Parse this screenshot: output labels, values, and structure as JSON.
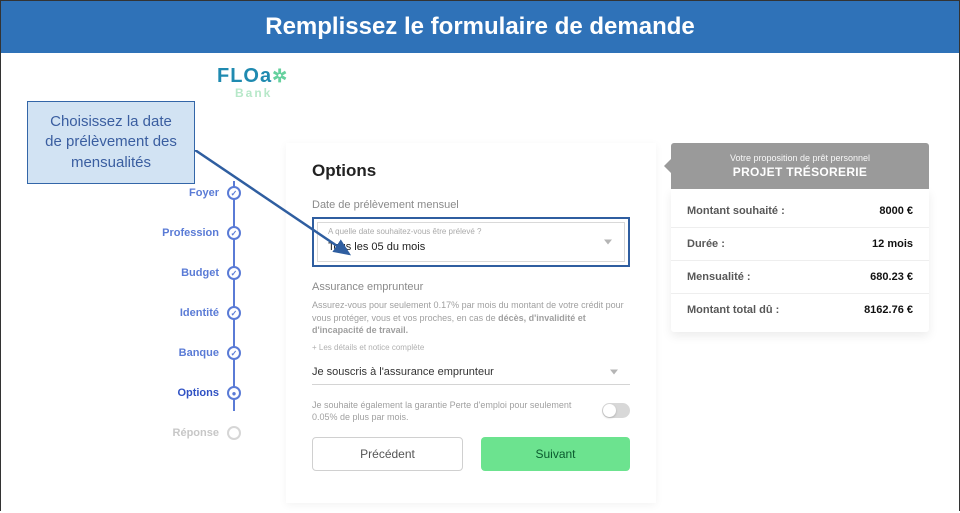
{
  "header": {
    "title": "Remplissez le formulaire de demande"
  },
  "logo": {
    "brand": "FLOa",
    "accent": "✲",
    "sub": "Bank"
  },
  "callout": {
    "text": "Choisissez la date de prélèvement des mensualités"
  },
  "steps": [
    {
      "label": "Foyer"
    },
    {
      "label": "Profession"
    },
    {
      "label": "Budget"
    },
    {
      "label": "Identité"
    },
    {
      "label": "Banque"
    },
    {
      "label": "Options"
    },
    {
      "label": "Réponse"
    }
  ],
  "form": {
    "title": "Options",
    "date_section_label": "Date de prélèvement mensuel",
    "date_select": {
      "mini_label": "A quelle date souhaitez-vous être prélevé ?",
      "value": "Tous les 05 du mois"
    },
    "insurance_section_label": "Assurance emprunteur",
    "insurance_info_prefix": "Assurez-vous pour seulement 0.17% par mois du montant de votre crédit pour vous protéger, vous et vos proches, en cas de ",
    "insurance_info_bold": "décès, d'invalidité et d'incapacité de travail.",
    "insurance_link": "+ Les détails et notice complète",
    "insurance_select_value": "Je souscris à l'assurance emprunteur",
    "jobloss_text": "Je souhaite également la garantie Perte d'emploi pour seulement 0.05% de plus par mois.",
    "prev_btn": "Précédent",
    "next_btn": "Suivant"
  },
  "summary": {
    "sub": "Votre proposition de prêt personnel",
    "main": "PROJET TRÉSORERIE",
    "rows": [
      {
        "k": "Montant souhaité :",
        "v": "8000 €"
      },
      {
        "k": "Durée :",
        "v": "12 mois"
      },
      {
        "k": "Mensualité :",
        "v": "680.23 €"
      },
      {
        "k": "Montant total dû :",
        "v": "8162.76 €"
      }
    ]
  }
}
